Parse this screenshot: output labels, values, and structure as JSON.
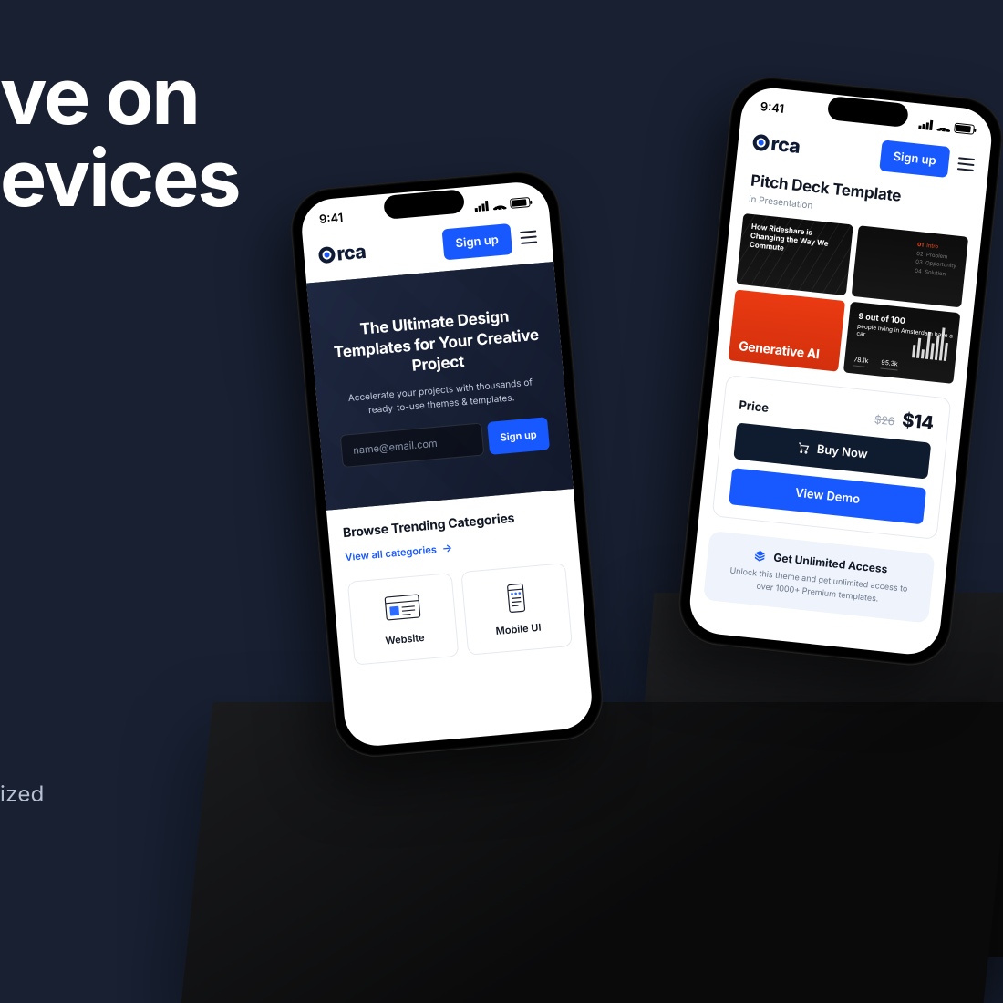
{
  "hero": {
    "line": "ve on\nevices",
    "sub": "ized"
  },
  "status": {
    "time": "9:41"
  },
  "brand": {
    "name": "rca"
  },
  "nav": {
    "signup_label": "Sign up"
  },
  "phoneA": {
    "hero_title": "The Ultimate Design Templates for Your Creative Project",
    "hero_sub": "Accelerate your projects with thousands of ready-to-use themes & templates.",
    "email_placeholder": "name@email.com",
    "email_cta": "Sign up",
    "section_title": "Browse Trending Categories",
    "view_all": "View all categories",
    "categories": [
      {
        "label": "Website"
      },
      {
        "label": "Mobile UI"
      }
    ]
  },
  "phoneB": {
    "title": "Pitch Deck Template",
    "crumb": "in Presentation",
    "slides": {
      "s1": "How Rideshare is Changing the Way We Commute",
      "s2": {
        "nums": [
          "01",
          "02",
          "03",
          "04"
        ],
        "labels": [
          "Intro",
          "Problem",
          "Opportunity",
          "Solution"
        ]
      },
      "s3": "Generative AI",
      "s4": {
        "headline": "9 out of 100",
        "sub": "people living in Amsterdam have a car",
        "fig1": "78.1k",
        "fig2": "95.3k"
      }
    },
    "price": {
      "label": "Price",
      "old": "$26",
      "new": "$14"
    },
    "buy": "Buy Now",
    "demo": "View Demo",
    "unlimited": {
      "title": "Get Unlimited Access",
      "copy": "Unlock this theme and get unlimited access to over 1000+ Premium templates."
    }
  }
}
